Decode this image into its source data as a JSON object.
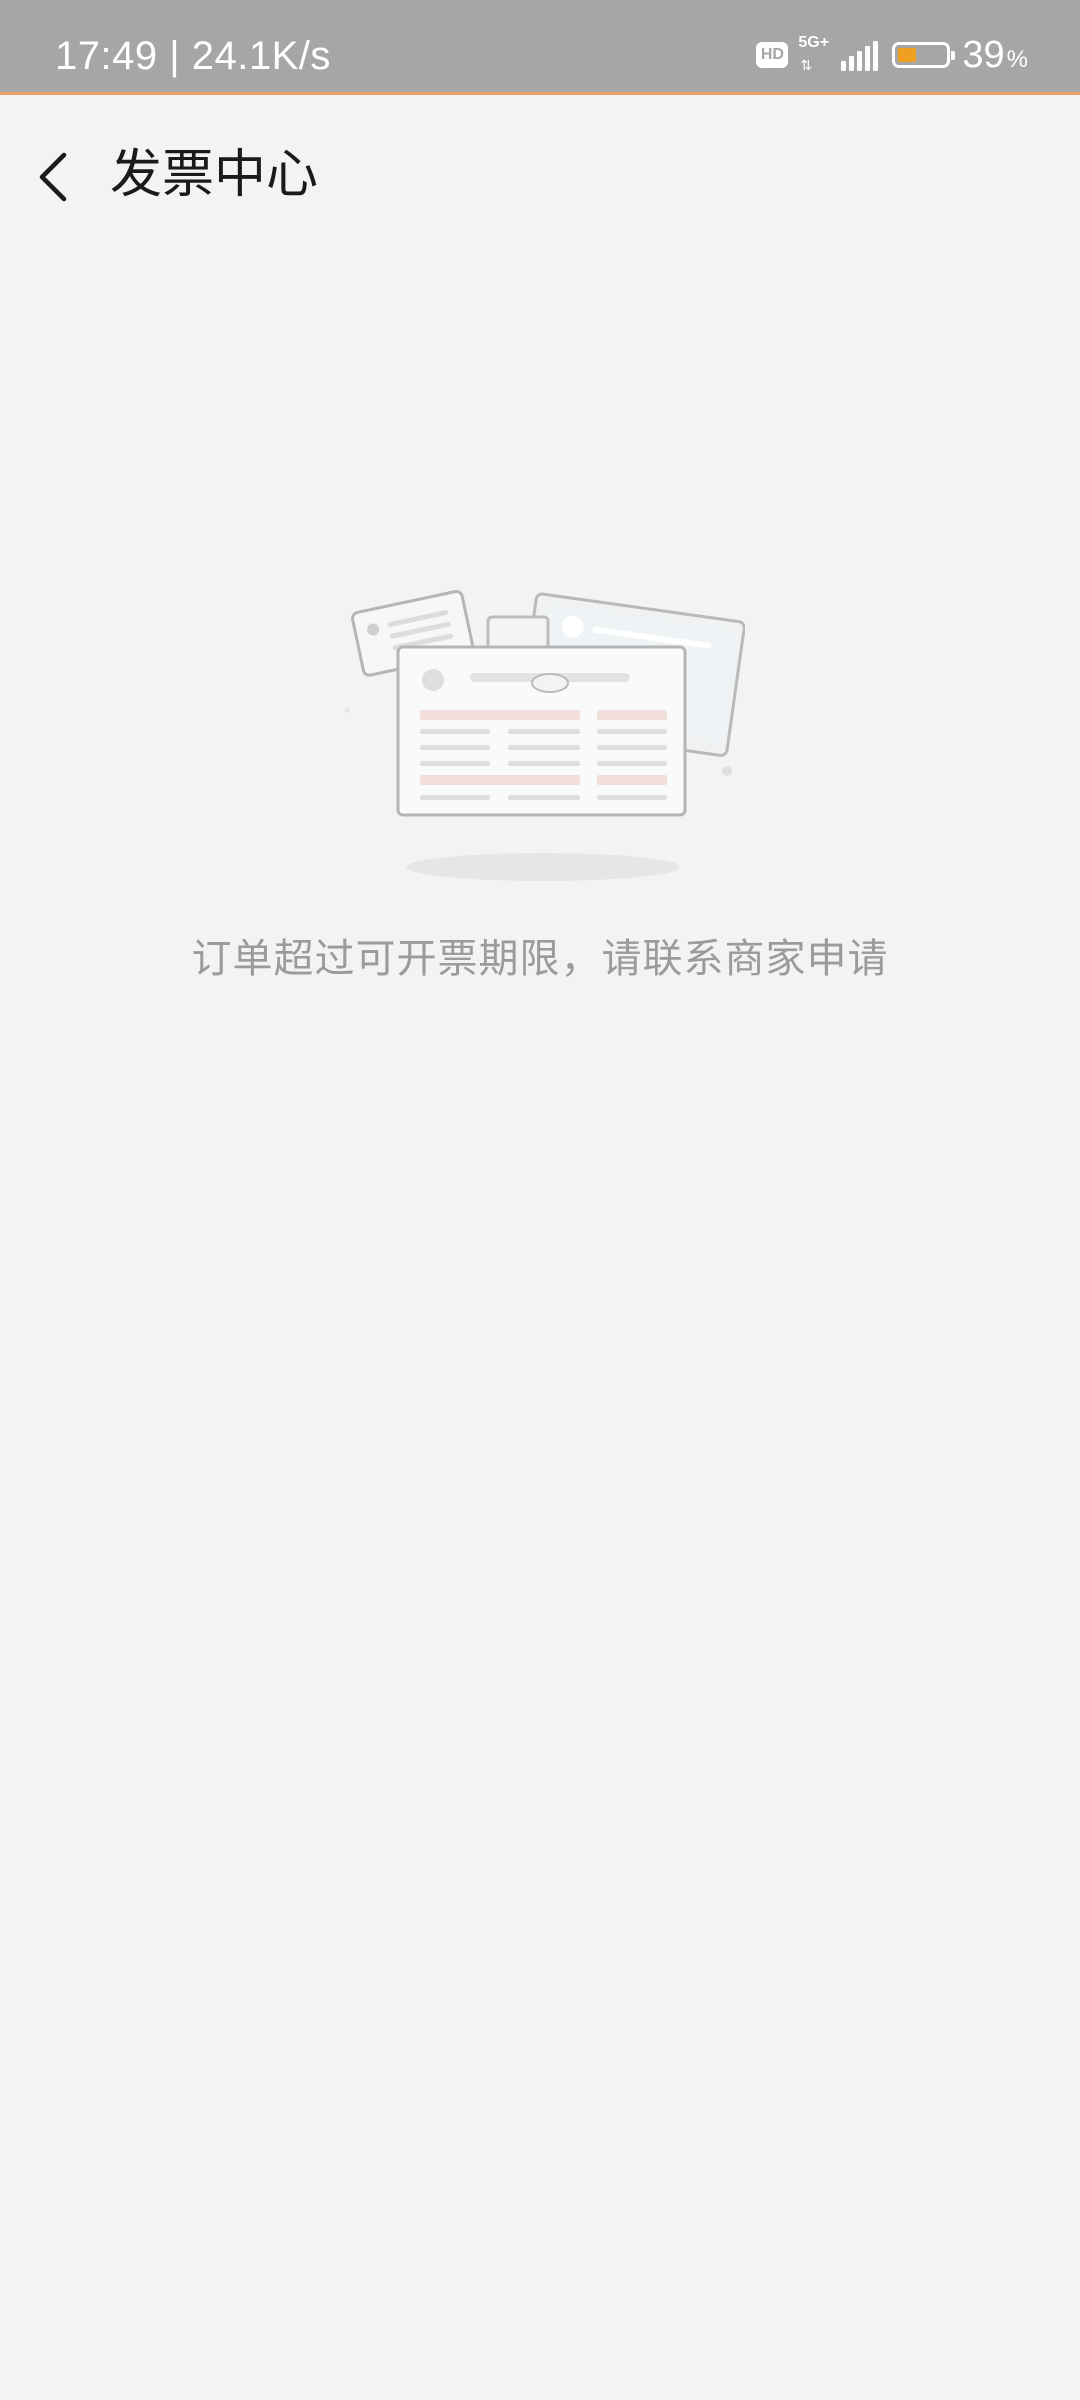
{
  "status_bar": {
    "time_speed": "17:49 | 24.1K/s",
    "hd_label": "HD",
    "network_type": "5G+",
    "network_arrows": "⇅",
    "battery_level": 0.39,
    "battery_percent": "39",
    "battery_percent_sign": "%",
    "battery_fill_color": "#f0a020"
  },
  "header": {
    "back_icon": "chevron-left-icon",
    "title": "发票中心"
  },
  "empty_state": {
    "illustration_icon": "invoice-documents-icon",
    "message": "订单超过可开票期限，请联系商家申请"
  },
  "colors": {
    "background": "#f3f3f3",
    "status_bar": "#a6a6a6",
    "status_bar_accent": "#e9a062",
    "title_text": "#1a1a1a",
    "message_text": "#9b9b9b"
  }
}
